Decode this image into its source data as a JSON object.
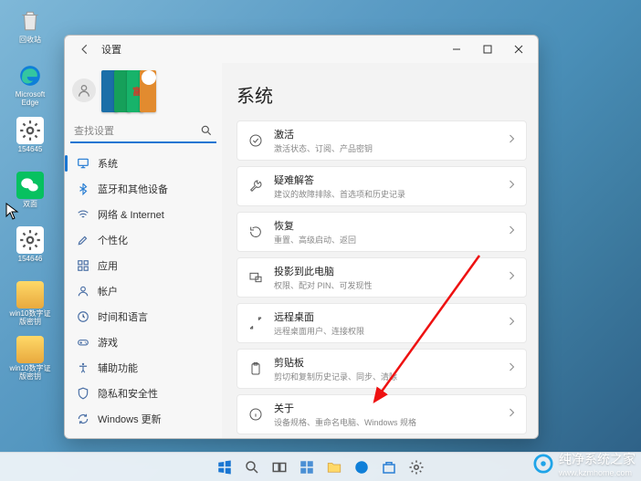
{
  "desktop_icons": [
    {
      "label": "回收站"
    },
    {
      "label": "Microsoft Edge"
    },
    {
      "label": "154645"
    },
    {
      "label": "双面"
    },
    {
      "label": "154646"
    },
    {
      "label": "win10数字证 版密钥"
    },
    {
      "label": "win10数字证 版密钥"
    }
  ],
  "window": {
    "title": "设置",
    "search_placeholder": "查找设置"
  },
  "sidebar": {
    "items": [
      {
        "label": "系统"
      },
      {
        "label": "蓝牙和其他设备"
      },
      {
        "label": "网络 & Internet"
      },
      {
        "label": "个性化"
      },
      {
        "label": "应用"
      },
      {
        "label": "帐户"
      },
      {
        "label": "时间和语言"
      },
      {
        "label": "游戏"
      },
      {
        "label": "辅助功能"
      },
      {
        "label": "隐私和安全性"
      },
      {
        "label": "Windows 更新"
      }
    ]
  },
  "main": {
    "title": "系统",
    "cards": [
      {
        "title": "激活",
        "subtitle": "激活状态、订阅、产品密钥"
      },
      {
        "title": "疑难解答",
        "subtitle": "建议的故障排除、首选项和历史记录"
      },
      {
        "title": "恢复",
        "subtitle": "重置、高级启动、返回"
      },
      {
        "title": "投影到此电脑",
        "subtitle": "权限、配对 PIN、可发现性"
      },
      {
        "title": "远程桌面",
        "subtitle": "远程桌面用户、连接权限"
      },
      {
        "title": "剪贴板",
        "subtitle": "剪切和复制历史记录、同步、清除"
      },
      {
        "title": "关于",
        "subtitle": "设备规格、重命名电脑、Windows 规格"
      }
    ]
  },
  "watermark": {
    "text": "纯净系统之家",
    "sub": "www.kzmhome.com"
  }
}
